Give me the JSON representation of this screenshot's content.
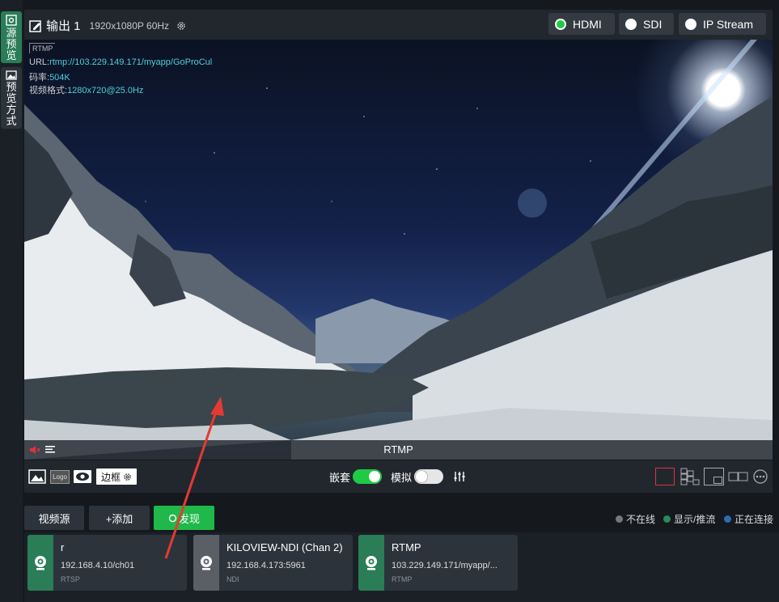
{
  "sidebar": {
    "tabs": [
      {
        "label": "源预览",
        "icon": "eye-icon",
        "active": true
      },
      {
        "label": "预览方式",
        "icon": "image-icon",
        "active": false
      }
    ]
  },
  "header": {
    "title": "输出 1",
    "resolution": "1920x1080P 60Hz",
    "outputs": [
      {
        "label": "HDMI",
        "selected": true
      },
      {
        "label": "SDI",
        "selected": false
      },
      {
        "label": "IP Stream",
        "selected": false
      }
    ]
  },
  "preview": {
    "tag": "RTMP",
    "info": [
      {
        "key": "URL:",
        "value": "rtmp://103.229.149.171/myapp/GoProCul"
      },
      {
        "key": "码率:",
        "value": "504K"
      },
      {
        "key": "视频格式:",
        "value": "1280x720@25.0Hz"
      }
    ],
    "source_label": "RTMP"
  },
  "toolbar": {
    "logo_label": "Logo",
    "border_label": "边框",
    "embed_label": "嵌套",
    "embed_on": true,
    "analog_label": "模拟",
    "analog_on": false
  },
  "controls": {
    "video_source": "视频源",
    "add": "+添加",
    "discover": "发现",
    "legend": [
      {
        "label": "不在线",
        "color": "#777777"
      },
      {
        "label": "显示/推流",
        "color": "#2a8a5a"
      },
      {
        "label": "正在连接",
        "color": "#2c6bb5"
      }
    ]
  },
  "sources": [
    {
      "name": "r",
      "address": "192.168.4.10/ch01",
      "protocol": "RTSP",
      "status_color": "#2a7d56"
    },
    {
      "name": "KILOVIEW-NDI (Chan 2)",
      "address": "192.168.4.173:5961",
      "protocol": "NDI",
      "status_color": "#5a5f66"
    },
    {
      "name": "RTMP",
      "address": "103.229.149.171/myapp/...",
      "protocol": "RTMP",
      "status_color": "#2a7d56"
    }
  ],
  "colors": {
    "accent_green": "#1fcb45",
    "discover_green": "#20b84a",
    "highlight_red": "#e0333f"
  }
}
